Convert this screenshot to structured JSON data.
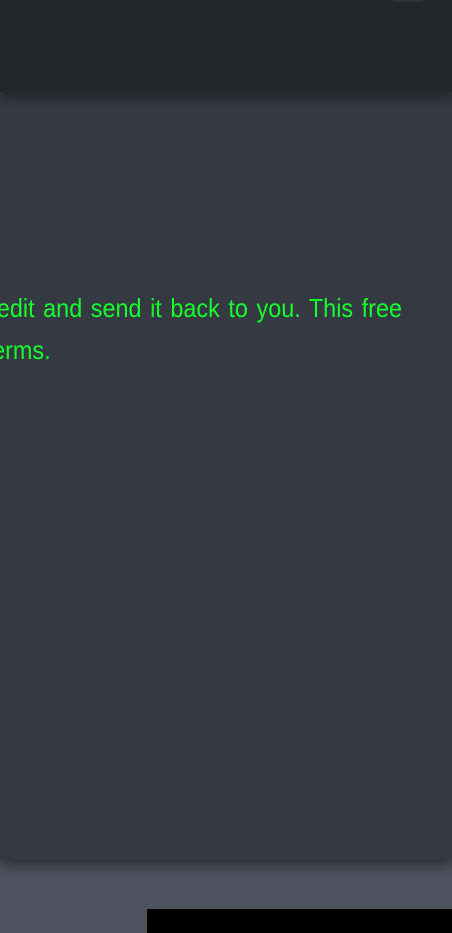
{
  "modal": {
    "message": "Send us a picture and we’ll edit and send it back to you. This free service is subject to certain terms."
  }
}
